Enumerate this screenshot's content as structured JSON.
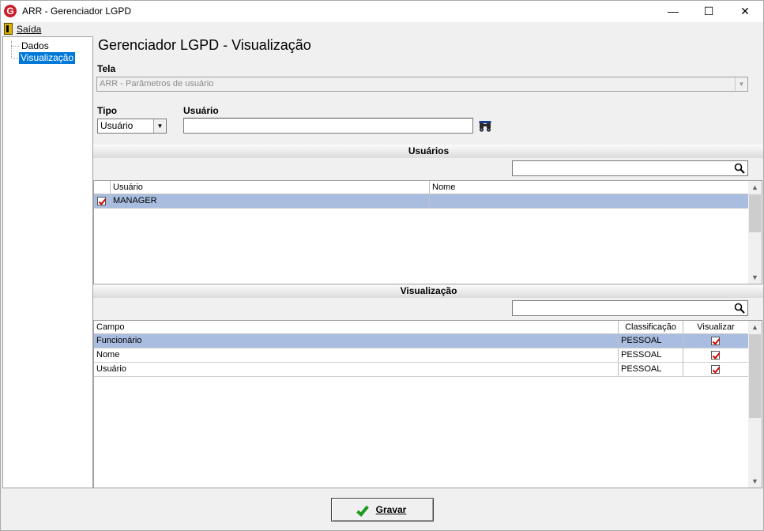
{
  "window": {
    "title": "ARR - Gerenciador LGPD",
    "logo_letter": "G",
    "minimize_glyph": "—",
    "maximize_glyph": "☐",
    "close_glyph": "✕"
  },
  "menu": {
    "exit_label": "Saída"
  },
  "tree": {
    "items": [
      "Dados",
      "Visualização"
    ],
    "selected": "Visualização"
  },
  "page": {
    "title": "Gerenciador LGPD - Visualização"
  },
  "form": {
    "tela_label": "Tela",
    "tela_value": "ARR - Parâmetros de usuário",
    "tipo_label": "Tipo",
    "tipo_value": "Usuário",
    "usuario_label": "Usuário",
    "usuario_value": ""
  },
  "users_section": {
    "title": "Usuários",
    "search_value": "",
    "columns": [
      "Usuário",
      "Nome"
    ],
    "rows": [
      {
        "checked": true,
        "usuario": "MANAGER",
        "nome": ""
      }
    ]
  },
  "view_section": {
    "title": "Visualização",
    "search_value": "",
    "columns": [
      "Campo",
      "Classificação",
      "Visualizar"
    ],
    "rows": [
      {
        "campo": "Funcionário",
        "classificacao": "PESSOAL",
        "visualizar": true
      },
      {
        "campo": "Nome",
        "classificacao": "PESSOAL",
        "visualizar": true
      },
      {
        "campo": "Usuário",
        "classificacao": "PESSOAL",
        "visualizar": true
      }
    ]
  },
  "footer": {
    "save_label": "Gravar"
  },
  "colors": {
    "selection": "#a9bde0",
    "tree_selection": "#0078d7",
    "logo": "#c8202a",
    "check": "#d00000",
    "save_check": "#1c9a1c"
  }
}
